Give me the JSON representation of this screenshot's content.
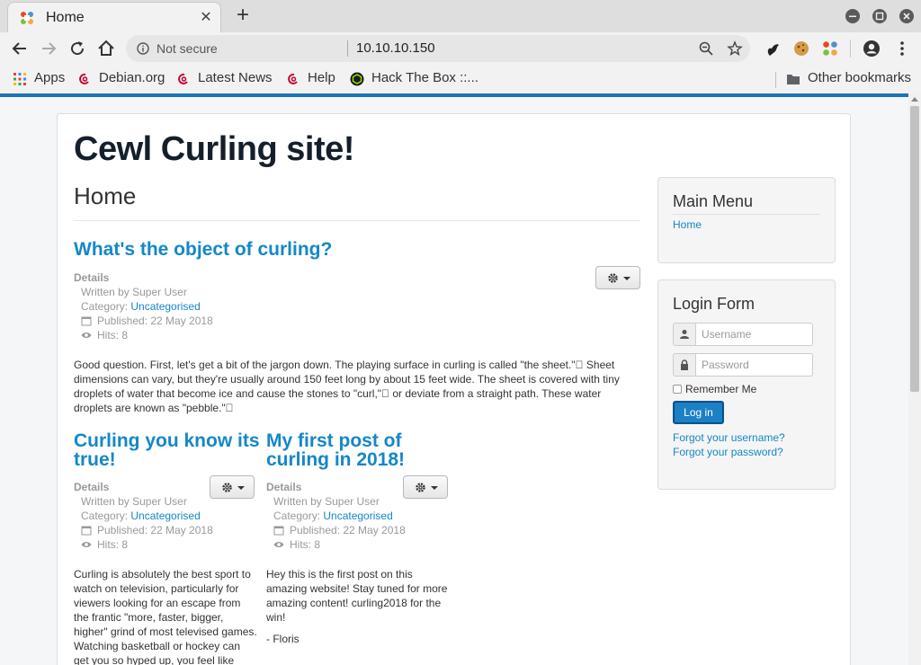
{
  "browser": {
    "tab": {
      "title": "Home",
      "close": "✕"
    },
    "new_tab": "+",
    "address": {
      "security": "Not secure",
      "url": "10.10.10.150"
    },
    "bookmarks": [
      {
        "label": "Apps",
        "icon": "apps-grid-icon"
      },
      {
        "label": "Debian.org",
        "icon": "debian-icon"
      },
      {
        "label": "Latest News",
        "icon": "debian-icon"
      },
      {
        "label": "Help",
        "icon": "debian-icon"
      },
      {
        "label": "Hack The Box ::...",
        "icon": "htb-icon"
      }
    ],
    "other_bookmarks": "Other bookmarks"
  },
  "site": {
    "title": "Cewl Curling site!",
    "page_heading": "Home",
    "articles": [
      {
        "title": "What's the object of curling?",
        "details": "Details",
        "author": "Written by Super User",
        "category_label": "Category: ",
        "category": "Uncategorised",
        "published": "Published: 22 May 2018",
        "hits": "Hits: 8",
        "body": "Good question. First, let's get a bit of the jargon down. The playing surface in curling is called \"the sheet.\"\u0000 Sheet dimensions can vary, but they're usually around 150 feet long by about 15 feet wide. The sheet is covered with tiny droplets of water that become ice and cause the stones to \"curl,\"\u0000 or deviate from a straight path. These water droplets are known as \"pebble.\"\u0000"
      },
      {
        "title_line1": "Curling you know its",
        "title_line2": "true!",
        "details": "Details",
        "author": "Written by Super User",
        "category_label": "Category: ",
        "category": "Uncategorised",
        "published": "Published: 22 May 2018",
        "hits": "Hits: 8",
        "body": "Curling is absolutely the best sport to watch on television, particularly for viewers looking for an escape from the frantic \"more, faster, bigger, higher\" grind of most televised games. Watching basketball or hockey can get you so hyped up, you feel like drinking"
      },
      {
        "title_line1": "My first post of",
        "title_line2": "curling in 2018!",
        "details": "Details",
        "author": "Written by Super User",
        "category_label": "Category: ",
        "category": "Uncategorised",
        "published": "Published: 22 May 2018",
        "hits": "Hits: 8",
        "body": "Hey this is the first post on this amazing website! Stay tuned for more amazing content! curling2018 for the win!",
        "signature": "- Floris"
      }
    ],
    "main_menu": {
      "title": "Main Menu",
      "items": [
        "Home"
      ]
    },
    "login": {
      "title": "Login Form",
      "username_placeholder": "Username",
      "password_placeholder": "Password",
      "remember": "Remember Me",
      "button": "Log in",
      "forgot_username": "Forgot your username?",
      "forgot_password": "Forgot your password?"
    }
  },
  "colors": {
    "accent": "#1487c8",
    "button": "#1c80c7",
    "top_border": "#1a74b8"
  }
}
